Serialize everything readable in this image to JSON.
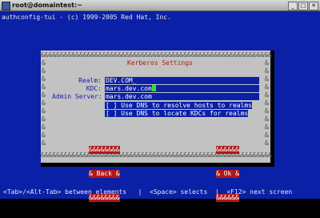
{
  "window": {
    "title": "root@domaintest:~",
    "minimize_glyph": "_",
    "maximize_glyph": "□",
    "close_glyph": "✕"
  },
  "terminal": {
    "header": "authconfig-tui - (c) 1999-2005 Red Hat, Inc.",
    "footer": "<Tab>/<Alt-Tab> between elements   |  <Space> selects  |  <F12> next screen"
  },
  "dialog": {
    "title": "Kerberos Settings",
    "border_fill": "&&&&&&&&&&&&&&&&&&&&&&&&&&&&&&&&&&&&&&&&&&&&&&&&&&&&&&&&&&&&",
    "fields": [
      {
        "label": "Realm:",
        "value": "DEV.COM_"
      },
      {
        "label": "KDC:",
        "value": "mars.dev.com"
      },
      {
        "label": "Admin Server:",
        "value": "mars.dev.com"
      }
    ],
    "checkboxes": [
      {
        "mark": "[ ]",
        "label": "Use DNS to resolve hosts to realms",
        "checked": false
      },
      {
        "mark": "[ ]",
        "label": "Use DNS to locate KDCs for realms",
        "checked": false
      }
    ],
    "buttons": {
      "back": {
        "top": "&&&&&&&&",
        "label": "& Back &",
        "bottom": "&&&&&&&&"
      },
      "ok": {
        "top": "&&&&&&",
        "label": "& Ok &",
        "bottom": "&&&&&&"
      }
    }
  },
  "colors": {
    "terminal_bg": "#0a20a6",
    "dialog_bg": "#c2c2c2",
    "title_red": "#b01818",
    "button_red": "#b01818",
    "label_blue": "#1a1aa6",
    "cursor_green": "#2ee02e"
  }
}
